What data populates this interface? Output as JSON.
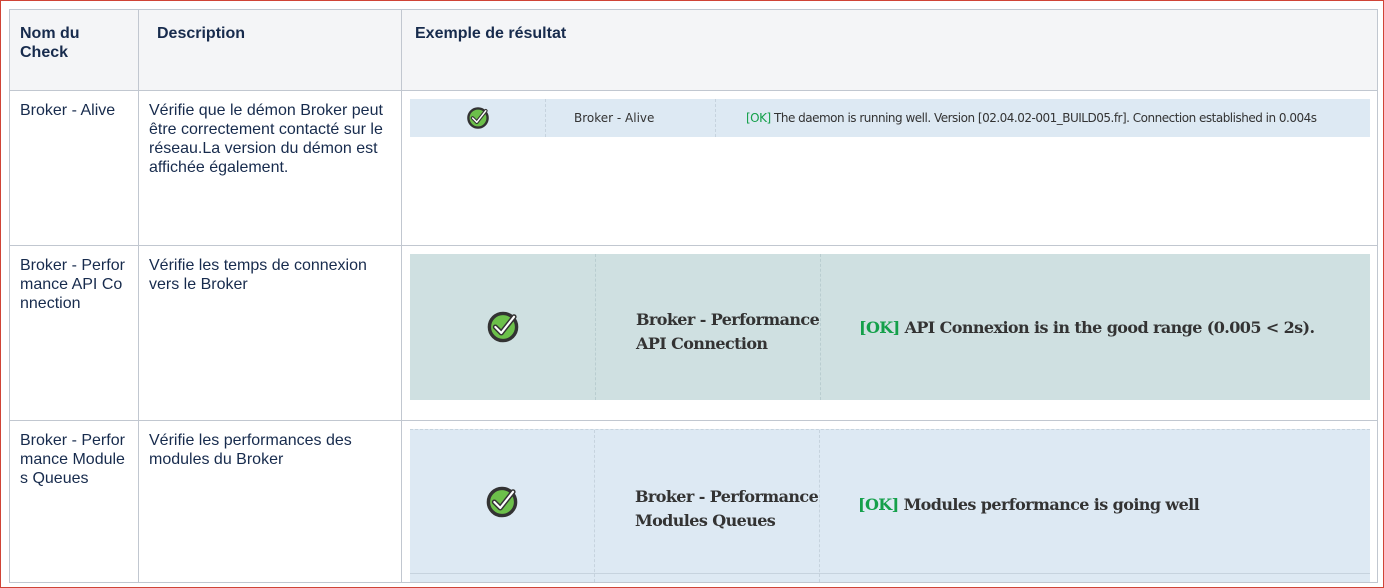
{
  "table": {
    "headers": {
      "name": "Nom du Check",
      "description": "Description",
      "result": "Exemple de résultat"
    },
    "rows": [
      {
        "name": "Broker - Alive",
        "description": "Vérifie que le démon Broker peut être correctement contacté sur le réseau.La version du démon est affichée également.",
        "result": {
          "status_icon": "check-circle-icon",
          "check_name": "Broker - Alive",
          "status_tag": "[OK]",
          "message": " The daemon is running well. Version [02.04.02-001_BUILD05.fr]. Connection established in 0.004s"
        }
      },
      {
        "name": "Broker - Performance API Connection",
        "description": "Vérifie les temps de connexion vers le Broker",
        "result": {
          "status_icon": "check-circle-icon",
          "check_name": "Broker - Performance API Connection",
          "status_tag": "[OK]",
          "message": " API Connexion is in the good range (0.005 < 2s)."
        }
      },
      {
        "name": "Broker - Performance Modules Queues",
        "description": "Vérifie les performances des modules du Broker",
        "result": {
          "status_icon": "check-circle-icon",
          "check_name": "Broker - Performance Modules Queues",
          "status_tag": "[OK]",
          "message": " Modules performance is going well"
        }
      }
    ]
  },
  "colors": {
    "ok_green": "#14a04a",
    "icon_green": "#6cc04a",
    "header_bg": "#f4f5f7",
    "frame_border": "#d04437"
  }
}
